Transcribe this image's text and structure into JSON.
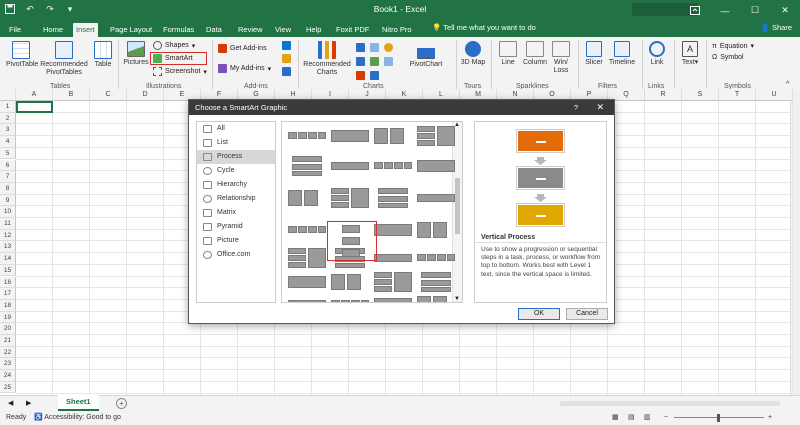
{
  "app": {
    "title": "Book1  -  Excel",
    "share_label": "Share",
    "tell_me": "Tell me what you want to do",
    "accent": "#217346"
  },
  "quick_access": [
    "save-icon",
    "undo-icon",
    "redo-icon",
    "customize-icon"
  ],
  "window_buttons": [
    "ribbon-display-icon",
    "minimize-icon",
    "maximize-icon",
    "close-icon"
  ],
  "tabs": [
    {
      "label": "File"
    },
    {
      "label": "Home"
    },
    {
      "label": "Insert"
    },
    {
      "label": "Page Layout"
    },
    {
      "label": "Formulas"
    },
    {
      "label": "Data"
    },
    {
      "label": "Review"
    },
    {
      "label": "View"
    },
    {
      "label": "Help"
    },
    {
      "label": "Foxit PDF"
    },
    {
      "label": "Nitro Pro"
    }
  ],
  "ribbon": {
    "pivottable": "PivotTable",
    "recommended_pivot": "Recommended PivotTables",
    "table": "Table",
    "pictures": "Pictures",
    "shapes": "Shapes",
    "smartart": "SmartArt",
    "screenshot": "Screenshot",
    "get_addins": "Get Add-ins",
    "my_addins": "My Add-ins",
    "recommended_charts": "Recommended Charts",
    "pivotchart": "PivotChart",
    "map3d": "3D Map",
    "line": "Line",
    "column": "Column",
    "winloss": "Win/ Loss",
    "slicer": "Slicer",
    "timeline": "Timeline",
    "link": "Link",
    "text": "Text",
    "equation": "Equation",
    "symbol": "Symbol",
    "groups": {
      "tables": "Tables",
      "illustrations": "Illustrations",
      "addins": "Add-ins",
      "charts": "Charts",
      "tours": "Tours",
      "sparklines": "Sparklines",
      "filters": "Filters",
      "links": "Links",
      "symbols": "Symbols"
    }
  },
  "grid": {
    "columns": [
      "A",
      "B",
      "C",
      "D",
      "E",
      "F",
      "G",
      "H",
      "I",
      "J",
      "K",
      "L",
      "M",
      "N",
      "O",
      "P",
      "Q",
      "R",
      "S",
      "T",
      "U"
    ],
    "rows": [
      "1",
      "2",
      "3",
      "4",
      "5",
      "6",
      "7",
      "8",
      "9",
      "10",
      "11",
      "12",
      "13",
      "14",
      "15",
      "16",
      "17",
      "18",
      "19",
      "20",
      "21",
      "22",
      "23",
      "24",
      "25"
    ]
  },
  "sheets": {
    "active": "Sheet1",
    "add_label": "+"
  },
  "status": {
    "ready": "Ready",
    "accessibility": "Accessibility: Good to go"
  },
  "dialog": {
    "title": "Choose a SmartArt Graphic",
    "help": "?",
    "categories": [
      {
        "label": "All"
      },
      {
        "label": "List"
      },
      {
        "label": "Process"
      },
      {
        "label": "Cycle"
      },
      {
        "label": "Hierarchy"
      },
      {
        "label": "Relationship"
      },
      {
        "label": "Matrix"
      },
      {
        "label": "Pyramid"
      },
      {
        "label": "Picture"
      },
      {
        "label": "Office.com"
      }
    ],
    "selected_category": "Process",
    "preview_title": "Vertical Process",
    "preview_desc": "Use to show a progression or sequential steps in a task, process, or workflow from top to bottom. Works best with Level 1 text, since the vertical space is limited.",
    "ok_label": "OK",
    "cancel_label": "Cancel",
    "preview_colors": [
      "#e36c0a",
      "#8a8a8a",
      "#e0a800"
    ]
  }
}
